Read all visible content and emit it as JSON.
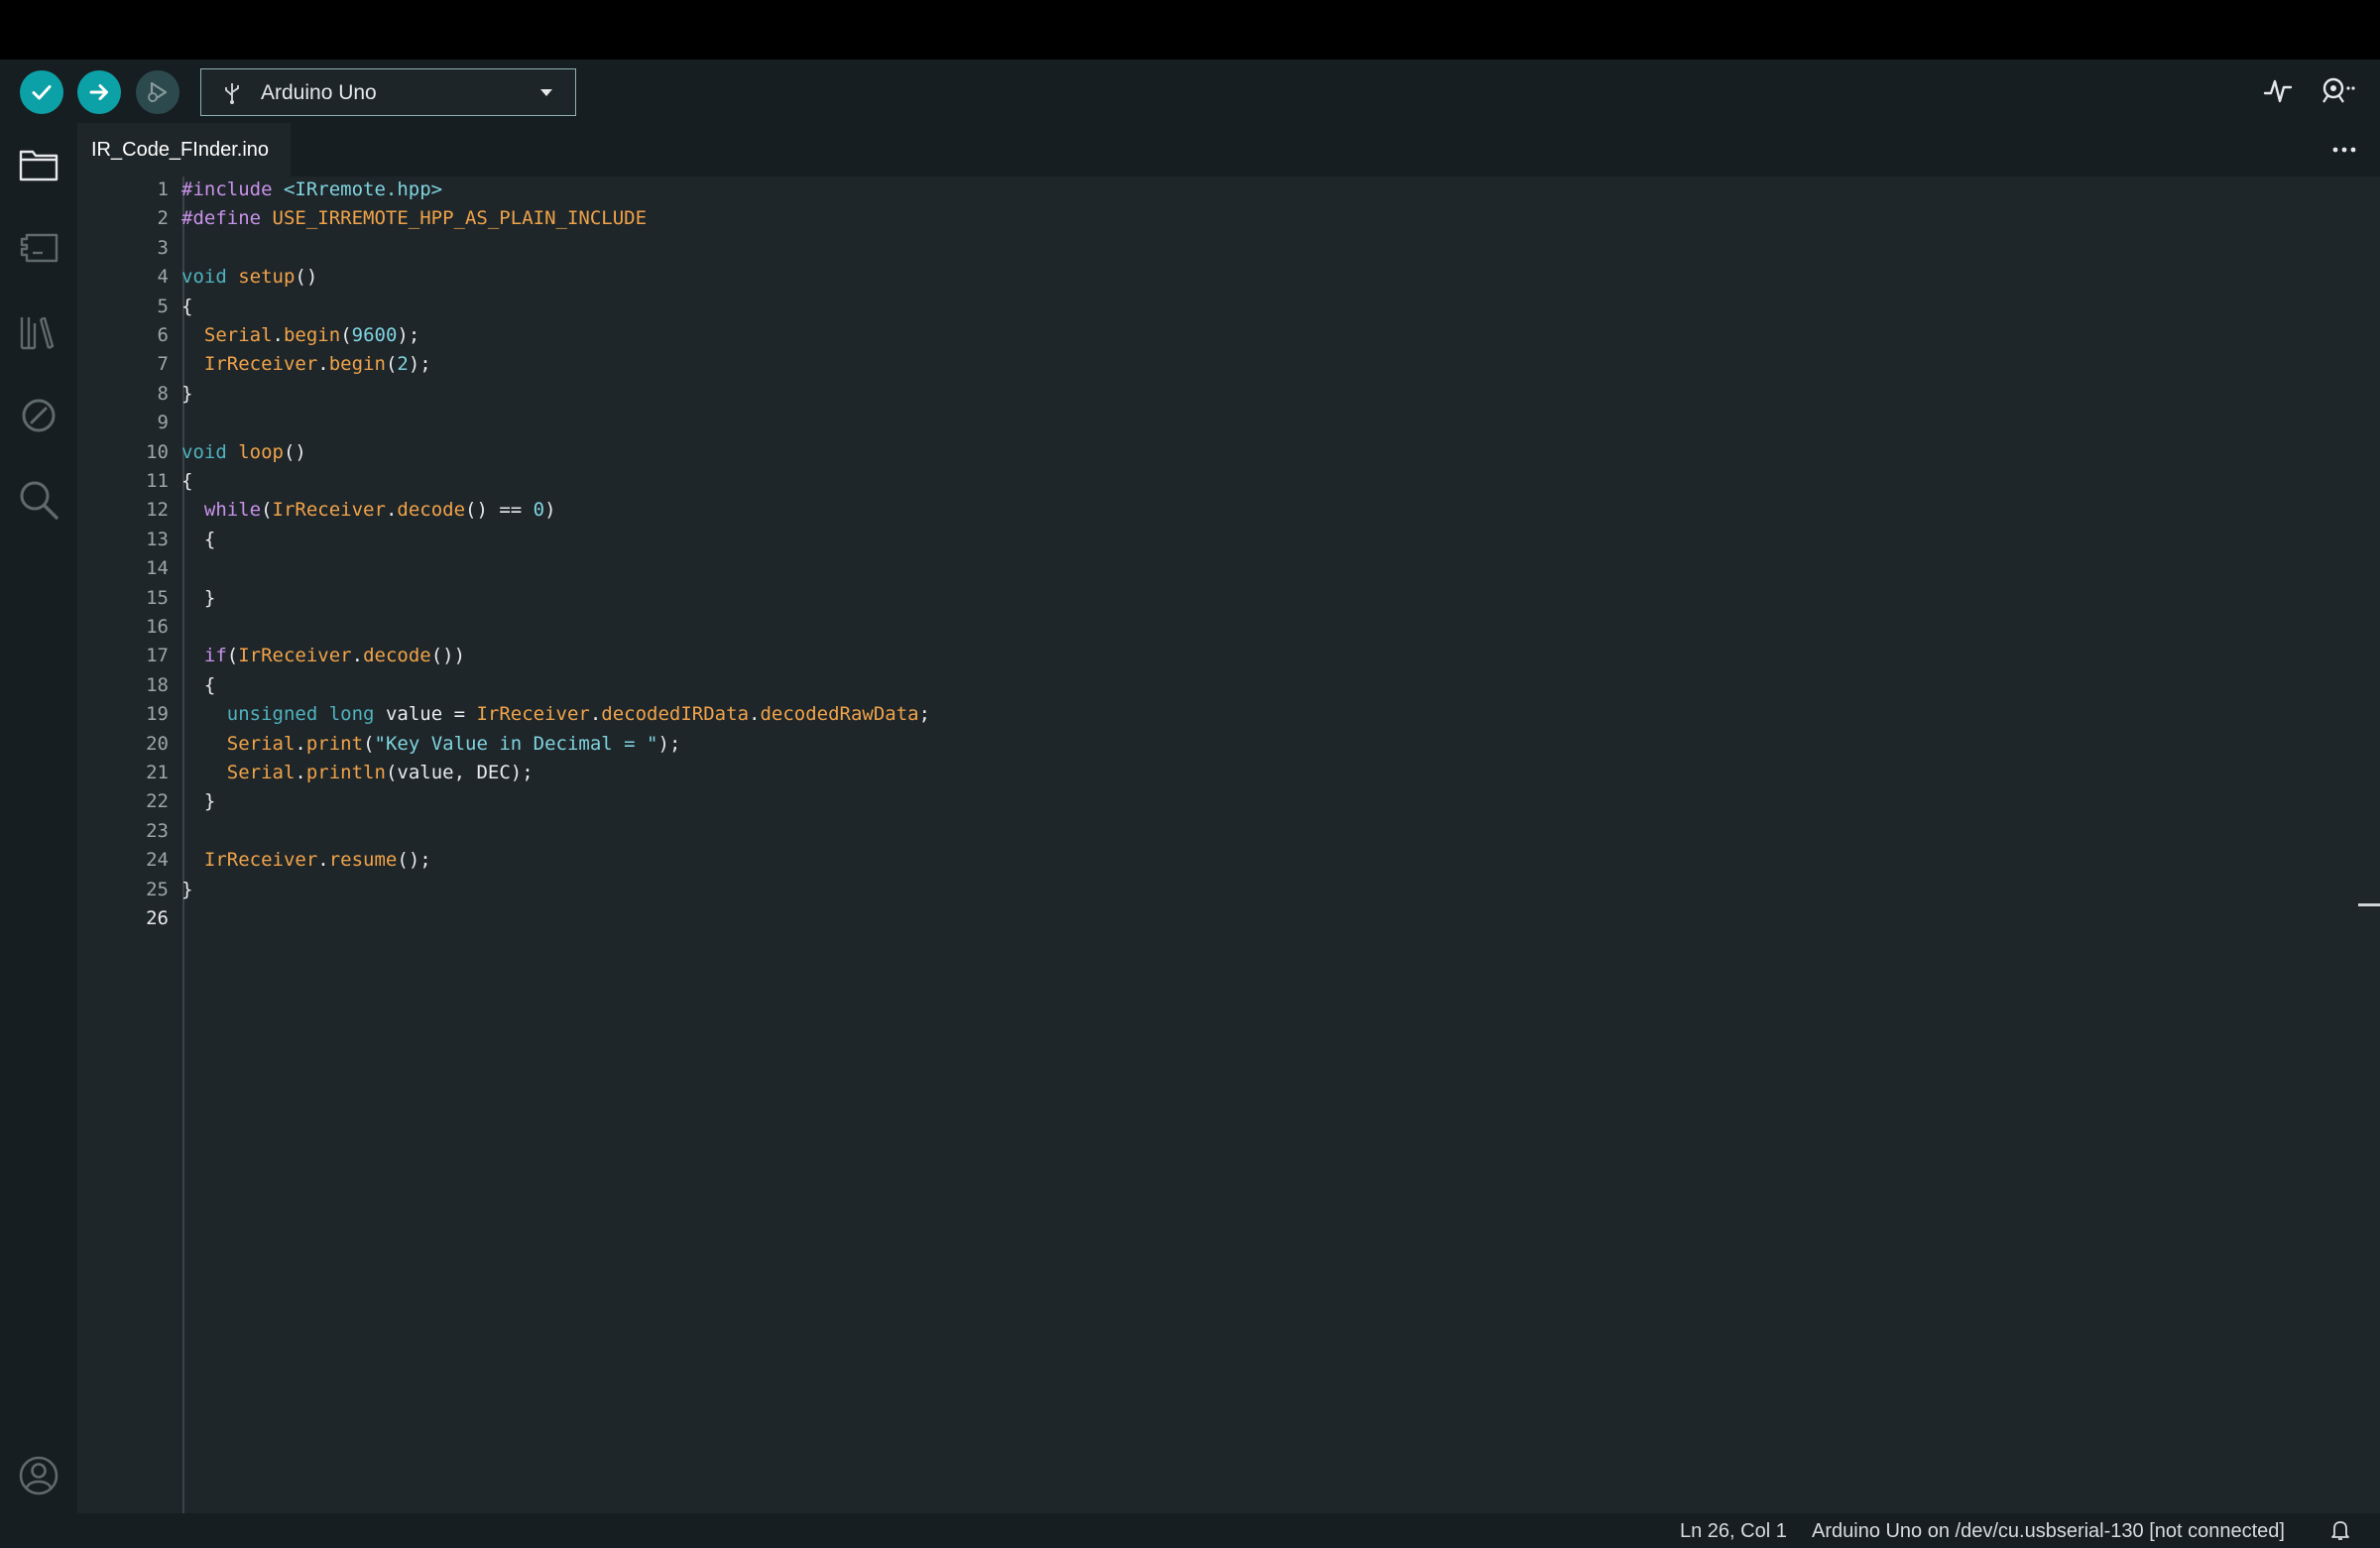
{
  "toolbar": {
    "board_label": "Arduino Uno"
  },
  "tab": {
    "filename": "IR_Code_FInder.ino"
  },
  "editor": {
    "line_numbers": [
      "1",
      "2",
      "3",
      "4",
      "5",
      "6",
      "7",
      "8",
      "9",
      "10",
      "11",
      "12",
      "13",
      "14",
      "15",
      "16",
      "17",
      "18",
      "19",
      "20",
      "21",
      "22",
      "23",
      "24",
      "25",
      "26"
    ],
    "lines": [
      "#include <IRremote.hpp>",
      "#define USE_IRREMOTE_HPP_AS_PLAIN_INCLUDE",
      "",
      "void setup()",
      "{",
      "  Serial.begin(9600);",
      "  IrReceiver.begin(2);",
      "}",
      "",
      "void loop()",
      "{",
      "  while(IrReceiver.decode() == 0)",
      "  {",
      "",
      "  }",
      "",
      "  if(IrReceiver.decode())",
      "  {",
      "    unsigned long value = IrReceiver.decodedIRData.decodedRawData;",
      "    Serial.print(\"Key Value in Decimal = \");",
      "    Serial.println(value, DEC);",
      "  }",
      "",
      "  IrReceiver.resume();",
      "}",
      ""
    ],
    "active_line": 26
  },
  "status": {
    "position": "Ln 26, Col 1",
    "board_port": "Arduino Uno on /dev/cu.usbserial-130 [not connected]"
  },
  "icons": {
    "verify": "check-icon",
    "upload": "arrow-right-icon",
    "debug": "debug-icon",
    "usb": "usb-icon",
    "plotter": "serial-plotter-icon",
    "monitor": "serial-monitor-icon",
    "sketchbook": "folder-icon",
    "boards": "board-manager-icon",
    "library": "library-icon",
    "debugger": "no-entry-icon",
    "search": "search-icon",
    "profile": "user-icon",
    "more": "more-icon",
    "bell": "bell-icon"
  },
  "colors": {
    "accent": "#0ca1a6",
    "background": "#1f2629",
    "chrome": "#171e21"
  }
}
